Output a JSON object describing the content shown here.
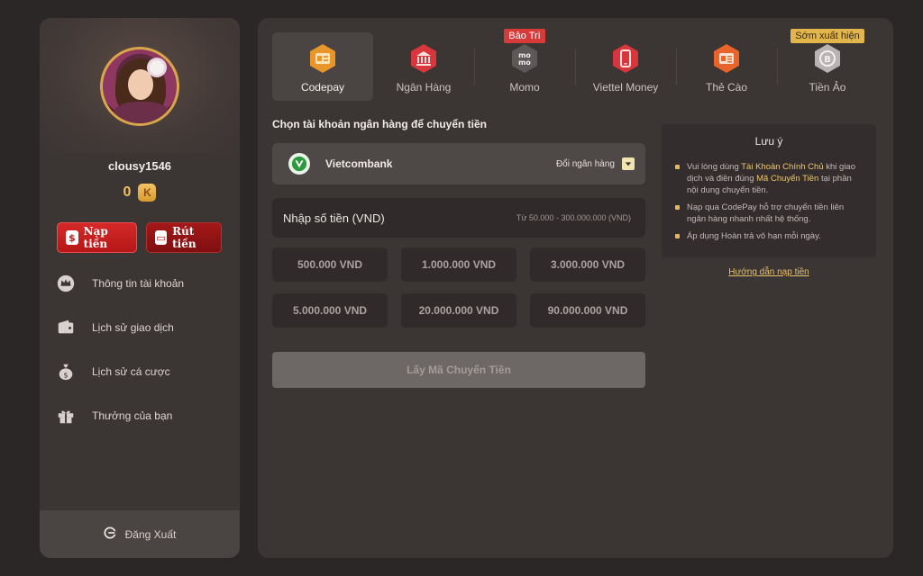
{
  "user": {
    "username": "clousy1546",
    "balance": "0",
    "currency_icon": "K"
  },
  "actions": {
    "deposit_label": "Nạp tiền",
    "withdraw_label": "Rút tiền"
  },
  "menu": {
    "items": [
      {
        "label": "Thông tin tài khoản",
        "icon": "crown-badge-icon"
      },
      {
        "label": "Lịch sử giao dịch",
        "icon": "wallet-icon"
      },
      {
        "label": "Lịch sử cá cược",
        "icon": "money-bag-icon"
      },
      {
        "label": "Thưởng của bạn",
        "icon": "gift-icon"
      }
    ],
    "logout_label": "Đăng Xuất"
  },
  "tabs": [
    {
      "label": "Codepay",
      "icon": "codepay-icon",
      "active": true
    },
    {
      "label": "Ngân Hàng",
      "icon": "bank-icon"
    },
    {
      "label": "Momo",
      "icon": "momo-icon",
      "badge": "Bảo Trì"
    },
    {
      "label": "Viettel Money",
      "icon": "phone-icon"
    },
    {
      "label": "Thẻ Cào",
      "icon": "card-icon"
    },
    {
      "label": "Tiền Ảo",
      "icon": "crypto-icon",
      "badge": "Sớm xuất hiện"
    }
  ],
  "deposit_form": {
    "section_title": "Chọn tài khoản ngân hàng để chuyển tiền",
    "bank_name": "Vietcombank",
    "change_bank_label": "Đổi ngân hàng",
    "amount_label": "Nhập số tiền (VND)",
    "amount_range": "Từ 50.000 - 300.000.000 (VND)",
    "preset_amounts": [
      "500.000 VND",
      "1.000.000 VND",
      "3.000.000 VND",
      "5.000.000 VND",
      "20.000.000 VND",
      "90.000.000 VND"
    ],
    "submit_label": "Lấy Mã Chuyển Tiền"
  },
  "notes": {
    "title": "Lưu ý",
    "item1": {
      "t1": "Vui lòng dùng ",
      "h1": "Tài Khoản Chính Chủ",
      "t2": " khi giao dịch và điền đúng ",
      "h2": "Mã Chuyển Tiền",
      "t3": " tại phần nội dung chuyển tiền."
    },
    "item2": "Nạp qua CodePay hỗ trợ chuyển tiền liên ngân hàng nhanh nhất hệ thống.",
    "item3": "Áp dụng Hoàn trả vô hạn mỗi ngày.",
    "guide_link": "Hướng dẫn nạp tiền"
  },
  "colors": {
    "accent_red": "#d72a2a",
    "accent_gold": "#f0c060",
    "panel_bg": "#3b3534",
    "page_bg": "#2b2726"
  }
}
